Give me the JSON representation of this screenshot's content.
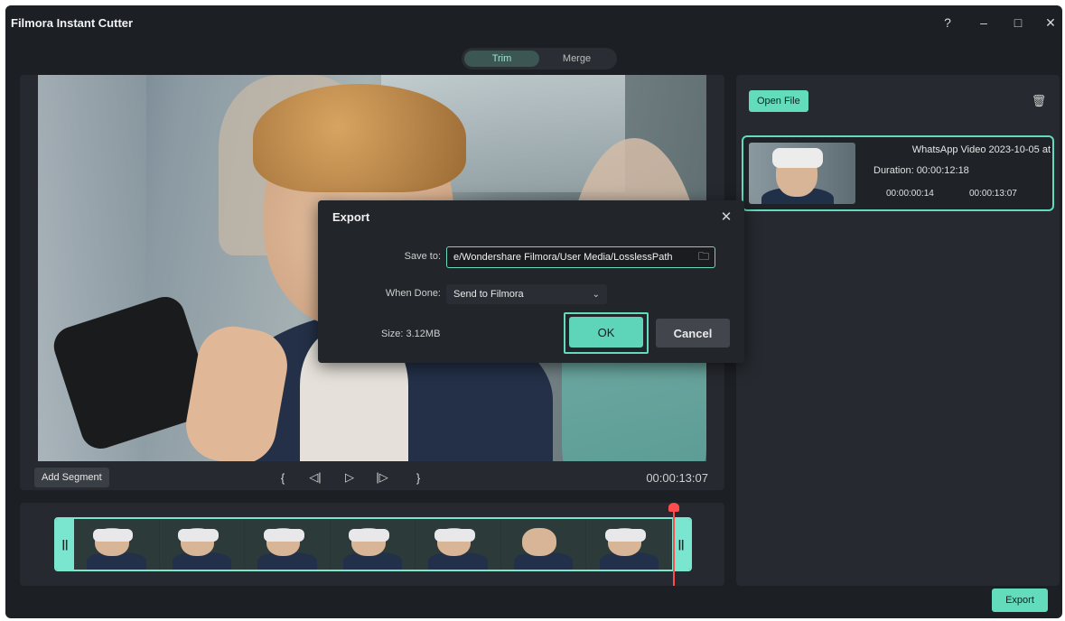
{
  "window": {
    "title": "Filmora Instant Cutter",
    "controls": {
      "help_icon": "?",
      "minimize_icon": "–",
      "maximize_icon": "□",
      "close_icon": "✕"
    }
  },
  "mode_tabs": [
    {
      "label": "Trim",
      "active": true
    },
    {
      "label": "Merge",
      "active": false
    }
  ],
  "player": {
    "add_segment_label": "Add Segment",
    "controls": {
      "mark_in_icon": "{",
      "prev_frame_icon": "◁|",
      "play_icon": "▷",
      "next_frame_icon": "|▷",
      "mark_out_icon": "}"
    },
    "timecode": "00:00:13:07"
  },
  "timeline": {
    "thumbnail_count": 7,
    "left_handle": "||",
    "right_handle": "||",
    "accent_color": "#7be6cf",
    "playhead_color": "#ff4d4d"
  },
  "file_panel": {
    "open_file_label": "Open File",
    "trash_icon": "🗑",
    "clip": {
      "title": "WhatsApp Video 2023-10-05 at",
      "duration": "Duration: 00:00:12:18",
      "in_time": "00:00:00:14",
      "out_time": "00:00:13:07"
    }
  },
  "export_button_label": "Export",
  "export_dialog": {
    "title": "Export",
    "close_icon": "✕",
    "save_to_label": "Save to:",
    "save_to_value": "e/Wondershare Filmora/User Media/LosslessPath",
    "folder_icon": "🗀",
    "when_done_label": "When Done:",
    "when_done_value": "Send to Filmora",
    "chevron_icon": "⌄",
    "size_label": "Size: 3.12MB",
    "ok_label": "OK",
    "cancel_label": "Cancel"
  },
  "colors": {
    "accent": "#63dbbd",
    "background": "#1c1f24",
    "panel": "#26292f"
  }
}
